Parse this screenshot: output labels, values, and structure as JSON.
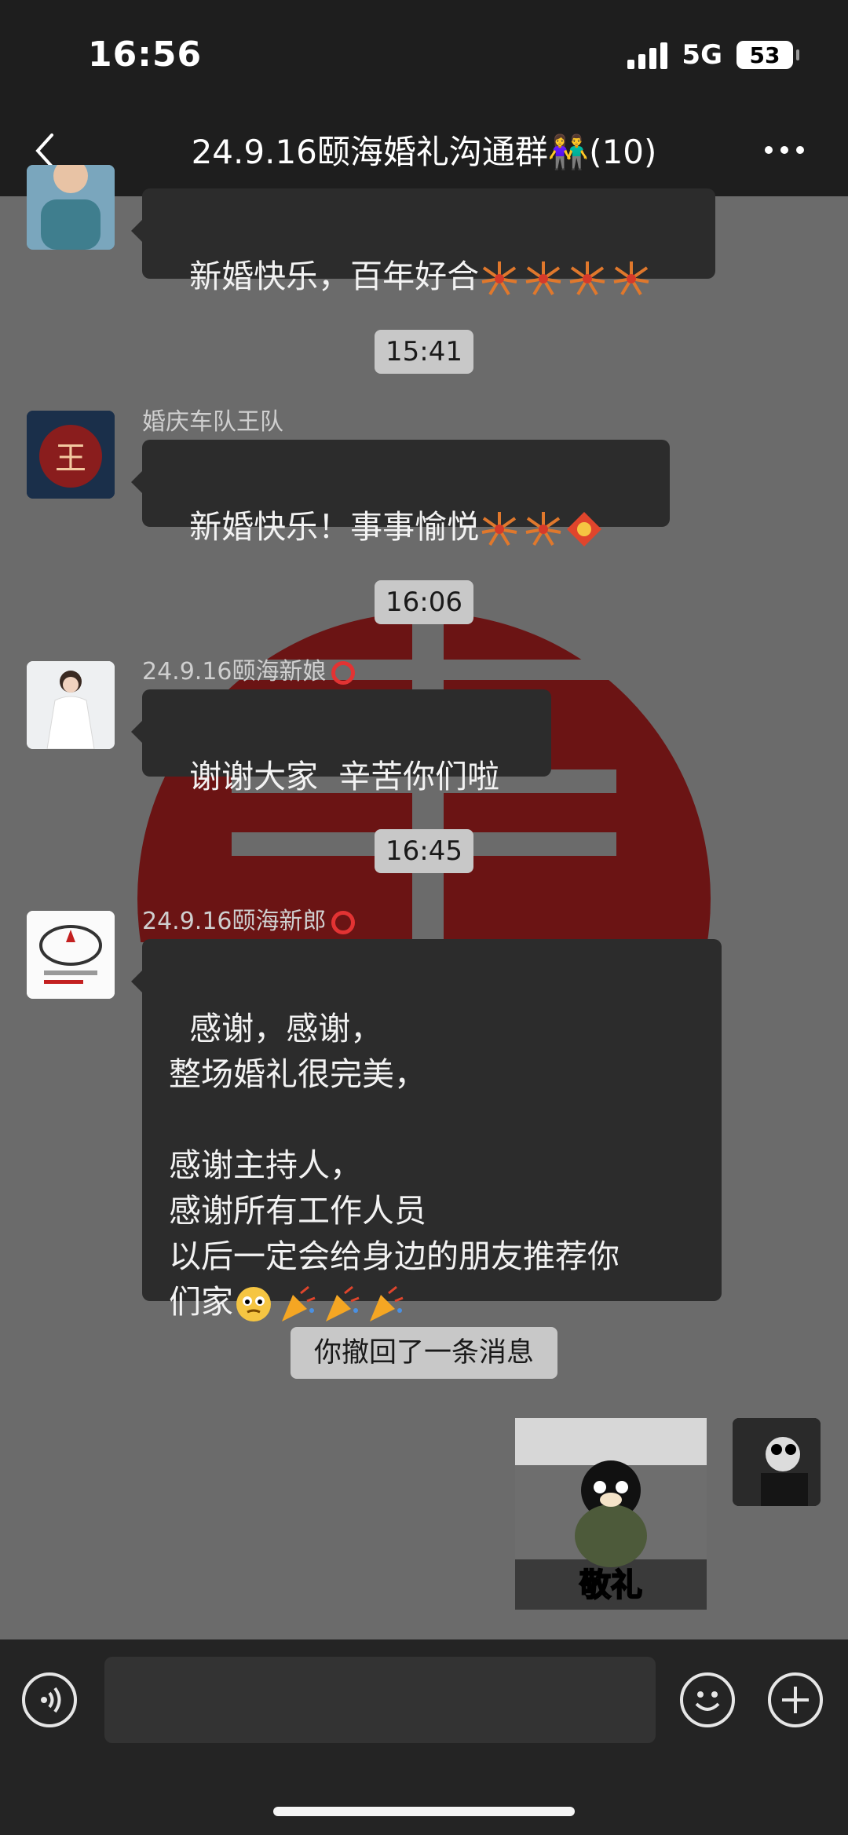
{
  "status_bar": {
    "time": "16:56",
    "network": "5G",
    "battery": "53"
  },
  "nav": {
    "title": "24.9.16颐海婚礼沟通群👫(10)"
  },
  "messages": [
    {
      "text": "新婚快乐，百年好合"
    },
    {
      "timestamp": "15:41",
      "sender": "婚庆车队王队",
      "text": "新婚快乐！事事愉悦"
    },
    {
      "timestamp": "16:06",
      "sender": "24.9.16颐海新娘",
      "text": "谢谢大家  辛苦你们啦"
    },
    {
      "timestamp": "16:45",
      "sender": "24.9.16颐海新郎",
      "text": "感谢，感谢，\n整场婚礼很完美，\n\n感谢主持人，\n感谢所有工作人员\n以后一定会给身边的朋友推荐你\n们家"
    }
  ],
  "recall_notice": "你撤回了一条消息",
  "sticker": {
    "caption": "敬礼"
  },
  "avatars": {
    "car_team_text": "王"
  },
  "icons": {
    "back": "chevron-left-icon",
    "more": "more-dots-icon",
    "voice": "voice-icon",
    "emoji": "smiley-icon",
    "add": "plus-icon",
    "fireworks": "fireworks-icon",
    "fortune": "fortune-diamond-icon",
    "party": "party-popper-icon"
  },
  "colors": {
    "bubble": "#2c2c2c",
    "background": "#6b6b6b",
    "emblem": "#6b1414",
    "pill": "#c8c8c8"
  }
}
